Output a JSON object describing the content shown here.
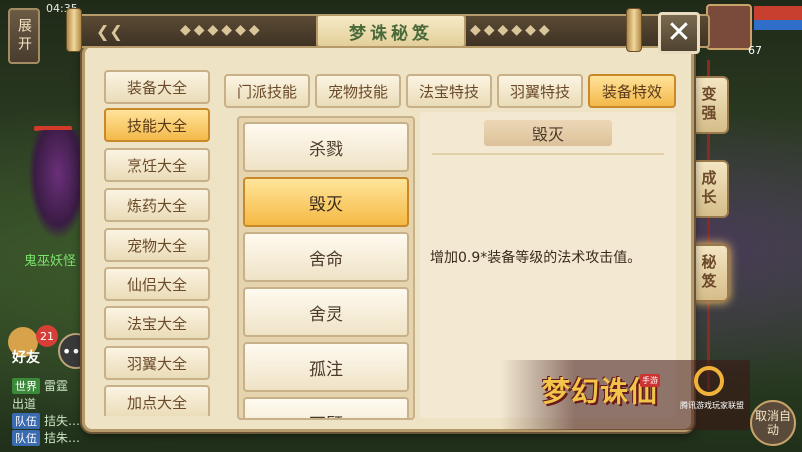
{
  "status_bar": {
    "time": "04:35"
  },
  "left_hud": {
    "expand_label": "展开"
  },
  "world": {
    "npc_name": "鬼巫妖怪",
    "friend_label": "好友",
    "friend_badge": "21",
    "chat_icon": "•••",
    "chat_lines": [
      {
        "tag": "世界",
        "tag_color": "#3a8a3a",
        "text": "雷霆"
      },
      {
        "tag": "",
        "tag_color": "#3a8a3a",
        "text": "出道"
      },
      {
        "tag": "队伍",
        "tag_color": "#3a6ab0",
        "text": "拮失…"
      },
      {
        "tag": "队伍",
        "tag_color": "#3a6ab0",
        "text": "拮朱…"
      }
    ],
    "player_level": "67",
    "auto_button_label": "取消自动"
  },
  "right_menu": [
    {
      "label": "变强",
      "active": false
    },
    {
      "label": "成长",
      "active": false
    },
    {
      "label": "秘笈",
      "active": true
    }
  ],
  "panel": {
    "title": "梦诛秘笈",
    "close_icon": "✕",
    "categories": [
      {
        "label": "装备大全",
        "active": false
      },
      {
        "label": "技能大全",
        "active": true
      },
      {
        "label": "烹饪大全",
        "active": false
      },
      {
        "label": "炼药大全",
        "active": false
      },
      {
        "label": "宠物大全",
        "active": false
      },
      {
        "label": "仙侣大全",
        "active": false
      },
      {
        "label": "法宝大全",
        "active": false
      },
      {
        "label": "羽翼大全",
        "active": false
      },
      {
        "label": "加点大全",
        "active": false
      }
    ],
    "tabs": [
      {
        "label": "门派技能",
        "active": false
      },
      {
        "label": "宠物技能",
        "active": false
      },
      {
        "label": "法宝特技",
        "active": false
      },
      {
        "label": "羽翼特技",
        "active": false
      },
      {
        "label": "装备特效",
        "active": true
      }
    ],
    "skills": [
      {
        "label": "杀戮",
        "active": false
      },
      {
        "label": "毁灭",
        "active": true
      },
      {
        "label": "舍命",
        "active": false
      },
      {
        "label": "舍灵",
        "active": false
      },
      {
        "label": "孤注",
        "active": false
      },
      {
        "label": "不顾",
        "active": false
      }
    ],
    "detail": {
      "title": "毁灭",
      "description": "增加0.9*装备等级的法术攻击值。"
    }
  },
  "logo": {
    "game_title": "梦幻诛仙",
    "tag": "手游",
    "publisher": "腾讯游戏玩家联盟"
  },
  "colors": {
    "panel_bg": "#efe3c6",
    "active_gold": "#f4b94a",
    "title_green": "#4a6a3a"
  }
}
